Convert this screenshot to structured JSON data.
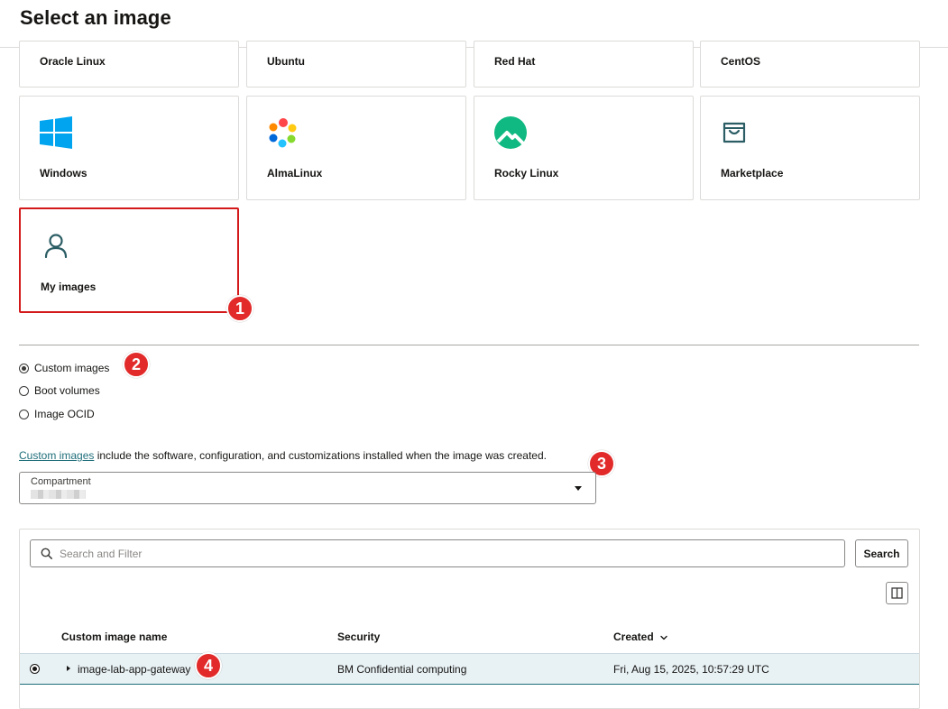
{
  "header": {
    "title": "Select an image"
  },
  "cards_top": [
    "Oracle Linux",
    "Ubuntu",
    "Red Hat",
    "CentOS"
  ],
  "cards": {
    "windows": "Windows",
    "alma": "AlmaLinux",
    "rocky": "Rocky Linux",
    "marketplace": "Marketplace",
    "my_images": "My images"
  },
  "badges": [
    "1",
    "2",
    "3",
    "4"
  ],
  "source_options": {
    "custom": "Custom images",
    "boot": "Boot volumes",
    "ocid": "Image OCID",
    "selected": "Custom images"
  },
  "description": {
    "link": "Custom images",
    "text": " include the software, configuration, and customizations installed when the image was created."
  },
  "compartment": {
    "label": "Compartment"
  },
  "search": {
    "placeholder": "Search and Filter",
    "button": "Search"
  },
  "table": {
    "headers": {
      "name": "Custom image name",
      "security": "Security",
      "created": "Created"
    },
    "rows": [
      {
        "name": "image-lab-app-gateway",
        "security": "BM Confidential computing",
        "created": "Fri, Aug 15, 2025, 10:57:29 UTC",
        "selected": true
      }
    ]
  },
  "colors": {
    "accent": "#1f6e7a",
    "highlight": "#d4191a",
    "badge": "#e12a29",
    "row_selected": "#e8f1f4"
  }
}
